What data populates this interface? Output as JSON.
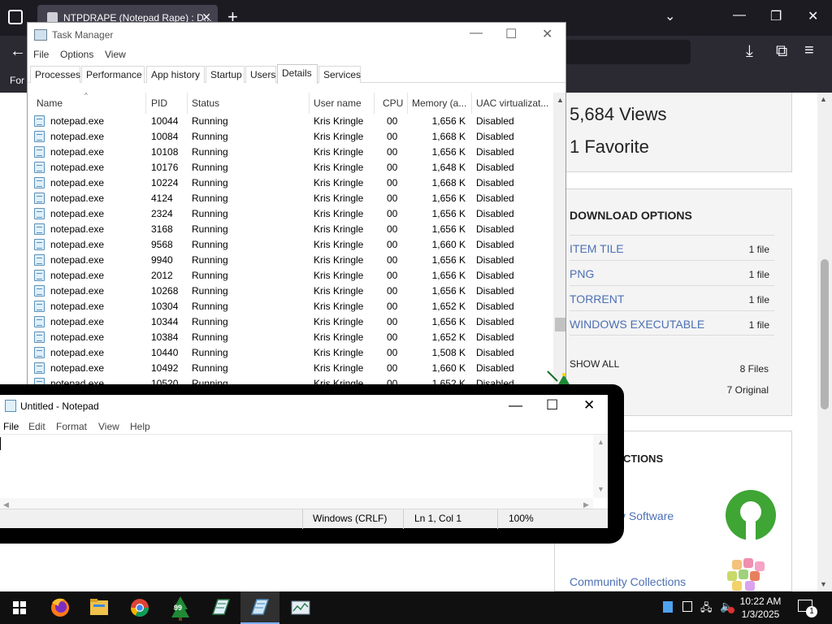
{
  "browser": {
    "tab_title": "NTPDRAPE (Notepad Rape) : D...",
    "tab_close": "✕",
    "new_tab": "+",
    "bookmark_partial": "For"
  },
  "webpage": {
    "views": "5,684 Views",
    "favorites": "1 Favorite",
    "download_title": "DOWNLOAD OPTIONS",
    "downloads": [
      {
        "label": "ITEM TILE",
        "count": "1 file"
      },
      {
        "label": "PNG",
        "count": "1 file"
      },
      {
        "label": "TORRENT",
        "count": "1 file"
      },
      {
        "label": "WINDOWS EXECUTABLE",
        "count": "1 file"
      }
    ],
    "show_all": "SHOW ALL",
    "files_count": "8 Files",
    "original_count": "7 Original",
    "collections_title": "CTIONS",
    "collection_links": [
      "y Software",
      "Community Collections"
    ]
  },
  "taskmgr": {
    "title": "Task Manager",
    "menu": [
      "File",
      "Options",
      "View"
    ],
    "tabs": [
      "Processes",
      "Performance",
      "App history",
      "Startup",
      "Users",
      "Details",
      "Services"
    ],
    "active_tab": "Details",
    "columns": [
      "Name",
      "PID",
      "Status",
      "User name",
      "CPU",
      "Memory (a...",
      "UAC virtualizat..."
    ],
    "rows": [
      [
        "notepad.exe",
        "10044",
        "Running",
        "Kris Kringle",
        "00",
        "1,656 K",
        "Disabled"
      ],
      [
        "notepad.exe",
        "10084",
        "Running",
        "Kris Kringle",
        "00",
        "1,668 K",
        "Disabled"
      ],
      [
        "notepad.exe",
        "10108",
        "Running",
        "Kris Kringle",
        "00",
        "1,656 K",
        "Disabled"
      ],
      [
        "notepad.exe",
        "10176",
        "Running",
        "Kris Kringle",
        "00",
        "1,648 K",
        "Disabled"
      ],
      [
        "notepad.exe",
        "10224",
        "Running",
        "Kris Kringle",
        "00",
        "1,668 K",
        "Disabled"
      ],
      [
        "notepad.exe",
        "4124",
        "Running",
        "Kris Kringle",
        "00",
        "1,656 K",
        "Disabled"
      ],
      [
        "notepad.exe",
        "2324",
        "Running",
        "Kris Kringle",
        "00",
        "1,656 K",
        "Disabled"
      ],
      [
        "notepad.exe",
        "3168",
        "Running",
        "Kris Kringle",
        "00",
        "1,656 K",
        "Disabled"
      ],
      [
        "notepad.exe",
        "9568",
        "Running",
        "Kris Kringle",
        "00",
        "1,660 K",
        "Disabled"
      ],
      [
        "notepad.exe",
        "9940",
        "Running",
        "Kris Kringle",
        "00",
        "1,656 K",
        "Disabled"
      ],
      [
        "notepad.exe",
        "2012",
        "Running",
        "Kris Kringle",
        "00",
        "1,656 K",
        "Disabled"
      ],
      [
        "notepad.exe",
        "10268",
        "Running",
        "Kris Kringle",
        "00",
        "1,656 K",
        "Disabled"
      ],
      [
        "notepad.exe",
        "10304",
        "Running",
        "Kris Kringle",
        "00",
        "1,652 K",
        "Disabled"
      ],
      [
        "notepad.exe",
        "10344",
        "Running",
        "Kris Kringle",
        "00",
        "1,656 K",
        "Disabled"
      ],
      [
        "notepad.exe",
        "10384",
        "Running",
        "Kris Kringle",
        "00",
        "1,652 K",
        "Disabled"
      ],
      [
        "notepad.exe",
        "10440",
        "Running",
        "Kris Kringle",
        "00",
        "1,508 K",
        "Disabled"
      ],
      [
        "notepad.exe",
        "10492",
        "Running",
        "Kris Kringle",
        "00",
        "1,660 K",
        "Disabled"
      ],
      [
        "notepad.exe",
        "10520",
        "Running",
        "Kris Kringle",
        "00",
        "1,652 K",
        "Disabled"
      ]
    ]
  },
  "notepad": {
    "title": "Untitled - Notepad",
    "menu": [
      "File",
      "Edit",
      "Format",
      "View",
      "Help"
    ],
    "content": "",
    "status": {
      "line_ending": "Windows (CRLF)",
      "position": "Ln 1, Col 1",
      "zoom": "100%"
    }
  },
  "taskbar": {
    "apps": [
      "start-icon",
      "firefox-icon",
      "file-explorer-icon",
      "chrome-icon",
      "christmas-tree-app-icon",
      "notepad-app-icon",
      "notepad-icon",
      "task-manager-icon"
    ],
    "active_app": "notepad-icon",
    "tree_badge": "99",
    "time": "10:22 AM",
    "date": "1/3/2025",
    "notification_count": "1"
  },
  "colors": {
    "browser_dark": "#1c1b22",
    "link_blue": "#4d6fb4",
    "osi_green": "#3fa535",
    "taskbar": "#101010"
  }
}
